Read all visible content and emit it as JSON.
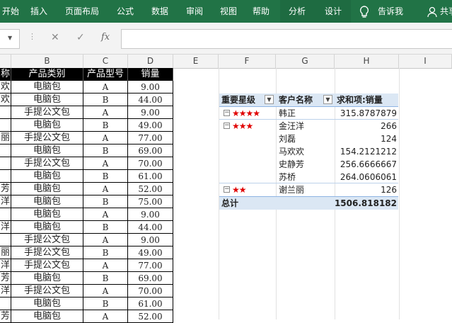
{
  "ribbon": {
    "tabs": [
      "开始",
      "插入",
      "页面布局",
      "公式",
      "数据",
      "审阅",
      "视图",
      "帮助",
      "分析",
      "设计"
    ],
    "tell_me": "告诉我",
    "share": "共享"
  },
  "formula_bar": {
    "cancel_icon": "✕",
    "enter_icon": "✓",
    "fx_icon": "fx",
    "value": ""
  },
  "columns": [
    "B",
    "C",
    "D",
    "E",
    "F",
    "G",
    "H",
    "I"
  ],
  "table": {
    "headers": [
      "称",
      "产品类别",
      "产品型号",
      "销量"
    ],
    "rows": [
      [
        "欢",
        "电脑包",
        "A",
        "9.00"
      ],
      [
        "欢",
        "电脑包",
        "B",
        "44.00"
      ],
      [
        "",
        "手提公文包",
        "A",
        "9.00"
      ],
      [
        "",
        "电脑包",
        "B",
        "49.00"
      ],
      [
        "丽",
        "手提公文包",
        "A",
        "77.00"
      ],
      [
        "",
        "电脑包",
        "B",
        "69.00"
      ],
      [
        "",
        "手提公文包",
        "A",
        "70.00"
      ],
      [
        "",
        "电脑包",
        "B",
        "61.00"
      ],
      [
        "芳",
        "电脑包",
        "A",
        "52.00"
      ],
      [
        "洋",
        "电脑包",
        "B",
        "75.00"
      ],
      [
        "",
        "电脑包",
        "A",
        "9.00"
      ],
      [
        "洋",
        "电脑包",
        "B",
        "44.00"
      ],
      [
        "",
        "手提公文包",
        "A",
        "9.00"
      ],
      [
        "丽",
        "手提公文包",
        "B",
        "49.00"
      ],
      [
        "洋",
        "手提公文包",
        "A",
        "77.00"
      ],
      [
        "芳",
        "电脑包",
        "B",
        "69.00"
      ],
      [
        "洋",
        "手提公文包",
        "A",
        "70.00"
      ],
      [
        "",
        "电脑包",
        "B",
        "61.00"
      ],
      [
        "芳",
        "电脑包",
        "A",
        "52.00"
      ]
    ]
  },
  "pivot": {
    "headers": [
      "重要星级",
      "客户名称",
      "求和项:销量"
    ],
    "groups": [
      {
        "stars": "★★★★",
        "rows": [
          {
            "name": "韩正",
            "value": "315.8787879"
          }
        ]
      },
      {
        "stars": "★★★",
        "rows": [
          {
            "name": "金汪洋",
            "value": "266"
          },
          {
            "name": "刘磊",
            "value": "124"
          },
          {
            "name": "马欢欢",
            "value": "154.2121212"
          },
          {
            "name": "史静芳",
            "value": "256.6666667"
          },
          {
            "name": "苏桥",
            "value": "264.0606061"
          }
        ]
      },
      {
        "stars": "★★",
        "rows": [
          {
            "name": "谢兰丽",
            "value": "126"
          }
        ]
      }
    ],
    "total_label": "总计",
    "total_value": "1506.818182"
  },
  "colors": {
    "ribbon": "#217346",
    "stars": "#e00000",
    "pivot_header": "#dbe7f4"
  }
}
